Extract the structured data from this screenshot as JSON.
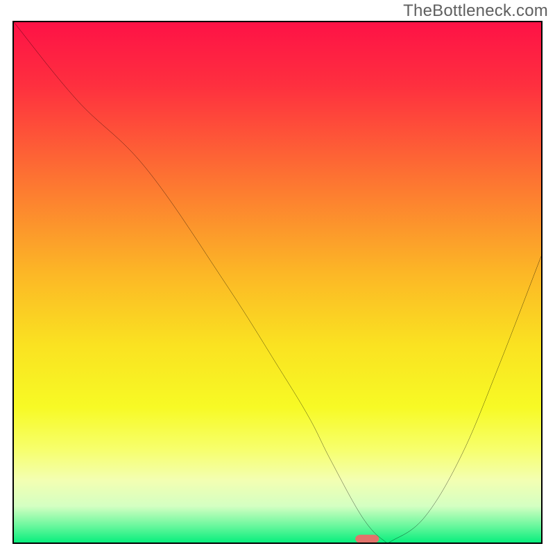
{
  "watermark": "TheBottleneck.com",
  "chart_data": {
    "type": "line",
    "title": "",
    "xlabel": "",
    "ylabel": "",
    "xlim": [
      0,
      100
    ],
    "ylim": [
      0,
      100
    ],
    "series": [
      {
        "name": "curve",
        "x": [
          0,
          12,
          25,
          40,
          50,
          56,
          60,
          66,
          70,
          72,
          78,
          85,
          92,
          100
        ],
        "y": [
          100,
          85,
          72,
          50,
          34,
          24,
          16,
          5,
          0.5,
          0.5,
          5,
          17,
          34,
          55
        ]
      }
    ],
    "marker": {
      "name": "indicator",
      "x": 67,
      "y": 0.7,
      "color": "#e2736b"
    },
    "gradient_stops": [
      {
        "offset": 0.0,
        "color": "#fe1246"
      },
      {
        "offset": 0.12,
        "color": "#fe2f3f"
      },
      {
        "offset": 0.3,
        "color": "#fd7332"
      },
      {
        "offset": 0.48,
        "color": "#fcb626"
      },
      {
        "offset": 0.62,
        "color": "#fae221"
      },
      {
        "offset": 0.74,
        "color": "#f7fa25"
      },
      {
        "offset": 0.82,
        "color": "#f7ff6b"
      },
      {
        "offset": 0.88,
        "color": "#f3ffb2"
      },
      {
        "offset": 0.93,
        "color": "#d4ffc2"
      },
      {
        "offset": 0.965,
        "color": "#72f8a0"
      },
      {
        "offset": 1.0,
        "color": "#09ee7d"
      }
    ]
  }
}
